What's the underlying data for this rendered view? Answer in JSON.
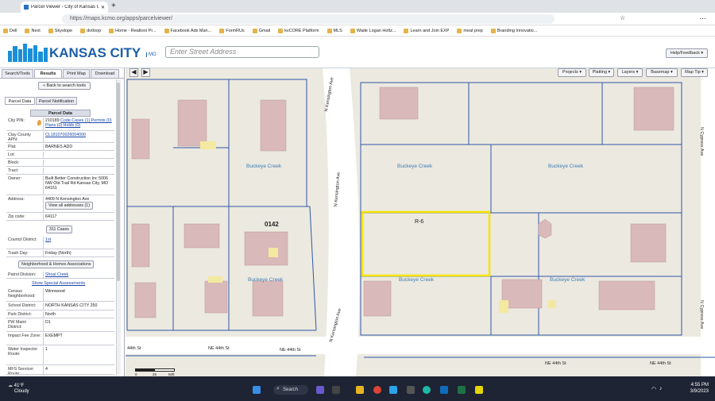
{
  "browser": {
    "tab_title": "Parcel Viewer - City of Kansas Ci",
    "url": "https://maps.kcmo.org/apps/parcelviewer/",
    "bookmarks": [
      "Dell",
      "Next",
      "Skyslope",
      "dotloop",
      "Home - Realtors Pr...",
      "Facebook Ads Man...",
      "FormRUs",
      "Gmail",
      "kvCORE Platform",
      "MLS",
      "Wade Logan Holtz...",
      "Learn and Join EXP",
      "meal prep",
      "Branding Innovatio..."
    ]
  },
  "header": {
    "logo_text": "KANSAS CITY",
    "logo_sub": "MO",
    "search_placeholder": "Enter Street Address",
    "help_label": "Help/Feedback"
  },
  "panel": {
    "top_tabs": [
      "Search/Tools",
      "Results",
      "Print Map",
      "Download"
    ],
    "back_label": "« Back to search tools",
    "sub_tabs": [
      "Parcel Data",
      "Parcel Notification"
    ],
    "title": "Parcel Data",
    "rows": [
      {
        "k": "City PIN:",
        "v": "210189",
        "extra": "Code Cases (1) Permits (0) Plans (0) Holds (0)"
      },
      {
        "k": "Clay County APN:",
        "v": "CL181070026004000"
      },
      {
        "k": "Plat:",
        "v": "BARNES ADD"
      },
      {
        "k": "Lot:",
        "v": ""
      },
      {
        "k": "Block:",
        "v": ""
      },
      {
        "k": "Tract:",
        "v": ""
      },
      {
        "k": "Owner:",
        "v": "Built Better Construction Inc 5006 NW Old Trail Rd Kansas City, MO 64151"
      },
      {
        "k": "Address:",
        "v": "4409 N Kensington Ave"
      },
      {
        "k": "Zip code:",
        "v": "64117"
      },
      {
        "k": "Council District:",
        "v": "1st"
      },
      {
        "k": "Trash Day:",
        "v": "Friday (North)"
      },
      {
        "k": "Patrol Division:",
        "v": "Shoal Creek"
      },
      {
        "k": "Census Neighborhood:",
        "v": "Winnwood"
      },
      {
        "k": "School District:",
        "v": "NORTH KANSAS CITY 250"
      },
      {
        "k": "Park District:",
        "v": "North"
      },
      {
        "k": "PW Maint District:",
        "v": "D1"
      },
      {
        "k": "Impact Fee Zone:",
        "v": "EXEMPT"
      },
      {
        "k": "Water Inspector Route:",
        "v": "1"
      },
      {
        "k": "MFS Servicer Route:",
        "v": "4"
      }
    ],
    "view_addresses": "View all addresses (1)",
    "cases_311": "311 Cases",
    "neighborhood_btn": "Neighborhood & Homes Associations",
    "special_assess": "Show Special Assessments"
  },
  "map": {
    "toolbar": [
      "Projects",
      "Platting",
      "Layers",
      "Basemap",
      "Map Tip"
    ],
    "labels": {
      "creek": "Buckeye Creek",
      "block": "0142",
      "zoning": "R-6",
      "kensington": "N Kensington Ave",
      "cypress": "N Cypress Ave",
      "ne44": "NE 44th St",
      "w44": "44th St"
    },
    "scale": [
      "0",
      "25",
      "50ft"
    ]
  },
  "taskbar": {
    "temp": "41°F",
    "cond": "Cloudy",
    "search": "Search",
    "time": "4:55 PM",
    "date": "3/9/2023"
  },
  "colors": {
    "highlight": "#f5e400",
    "parcel_line": "#2f57a6",
    "building": "#d9b9b9",
    "street": "#ffffff"
  }
}
